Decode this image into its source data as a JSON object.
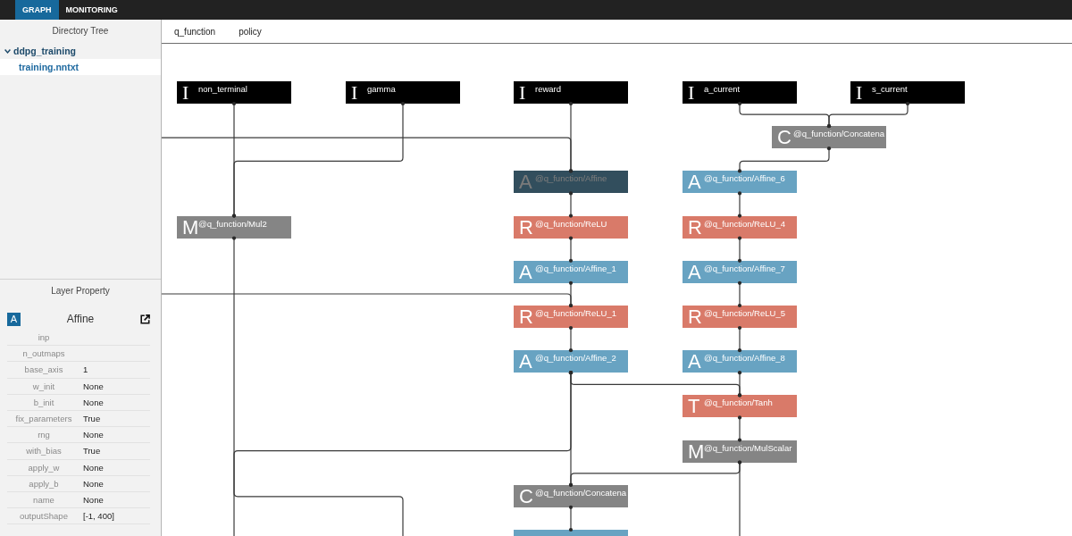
{
  "app_tabs": [
    {
      "label": "GRAPH",
      "selected": true
    },
    {
      "label": "MONITORING",
      "selected": false
    }
  ],
  "directory_tree": {
    "title": "Directory Tree",
    "items": [
      {
        "label": "ddpg_training",
        "expanded": true,
        "selected": false,
        "children": [
          {
            "label": "training.nntxt",
            "selected": true
          }
        ]
      }
    ]
  },
  "layer_property": {
    "title": "Layer Property",
    "layer": {
      "letter": "A",
      "name": "Affine"
    },
    "properties": [
      {
        "name": "inp"
      },
      {
        "name": "n_outmaps"
      },
      {
        "name": "base_axis",
        "value": "1"
      },
      {
        "name": "w_init",
        "value": "None"
      },
      {
        "name": "b_init",
        "value": "None"
      },
      {
        "name": "fix_parameters",
        "value": "True"
      },
      {
        "name": "rng",
        "value": "None"
      },
      {
        "name": "with_bias",
        "value": "True"
      },
      {
        "name": "apply_w",
        "value": "None"
      },
      {
        "name": "apply_b",
        "value": "None"
      },
      {
        "name": "name",
        "value": "None"
      },
      {
        "name": "outputShape",
        "value": "[-1, 400]"
      }
    ]
  },
  "network_tabs": [
    {
      "label": "q_function"
    },
    {
      "label": "policy"
    }
  ],
  "graph": {
    "nodes": [
      {
        "kind": "input",
        "letter": "I",
        "label": "non_terminal",
        "selected": false
      },
      {
        "kind": "input",
        "letter": "I",
        "label": "gamma",
        "selected": false
      },
      {
        "kind": "input",
        "letter": "I",
        "label": "reward",
        "selected": false
      },
      {
        "kind": "input",
        "letter": "I",
        "label": "a_current",
        "selected": false
      },
      {
        "kind": "input",
        "letter": "I",
        "label": "s_current",
        "selected": false
      },
      {
        "kind": "math",
        "letter": "C",
        "label": "@q_function/Concatena",
        "selected": false
      },
      {
        "kind": "affine",
        "letter": "A",
        "label": "@q_function/Affine",
        "selected": true
      },
      {
        "kind": "affine",
        "letter": "A",
        "label": "@q_function/Affine_6",
        "selected": false
      },
      {
        "kind": "math",
        "letter": "M",
        "label": "@q_function/Mul2",
        "selected": false
      },
      {
        "kind": "activation",
        "letter": "R",
        "label": "@q_function/ReLU",
        "selected": false
      },
      {
        "kind": "activation",
        "letter": "R",
        "label": "@q_function/ReLU_4",
        "selected": false
      },
      {
        "kind": "affine",
        "letter": "A",
        "label": "@q_function/Affine_1",
        "selected": false
      },
      {
        "kind": "affine",
        "letter": "A",
        "label": "@q_function/Affine_7",
        "selected": false
      },
      {
        "kind": "activation",
        "letter": "R",
        "label": "@q_function/ReLU_1",
        "selected": false
      },
      {
        "kind": "activation",
        "letter": "R",
        "label": "@q_function/ReLU_5",
        "selected": false
      },
      {
        "kind": "affine",
        "letter": "A",
        "label": "@q_function/Affine_2",
        "selected": false
      },
      {
        "kind": "affine",
        "letter": "A",
        "label": "@q_function/Affine_8",
        "selected": false
      },
      {
        "kind": "activation",
        "letter": "T",
        "label": "@q_function/Tanh",
        "selected": false
      },
      {
        "kind": "math",
        "letter": "M",
        "label": "@q_function/MulScalar",
        "selected": false
      },
      {
        "kind": "math",
        "letter": "C",
        "label": "@q_function/Concatena",
        "selected": false
      },
      {
        "kind": "affine",
        "selected": false
      }
    ]
  }
}
